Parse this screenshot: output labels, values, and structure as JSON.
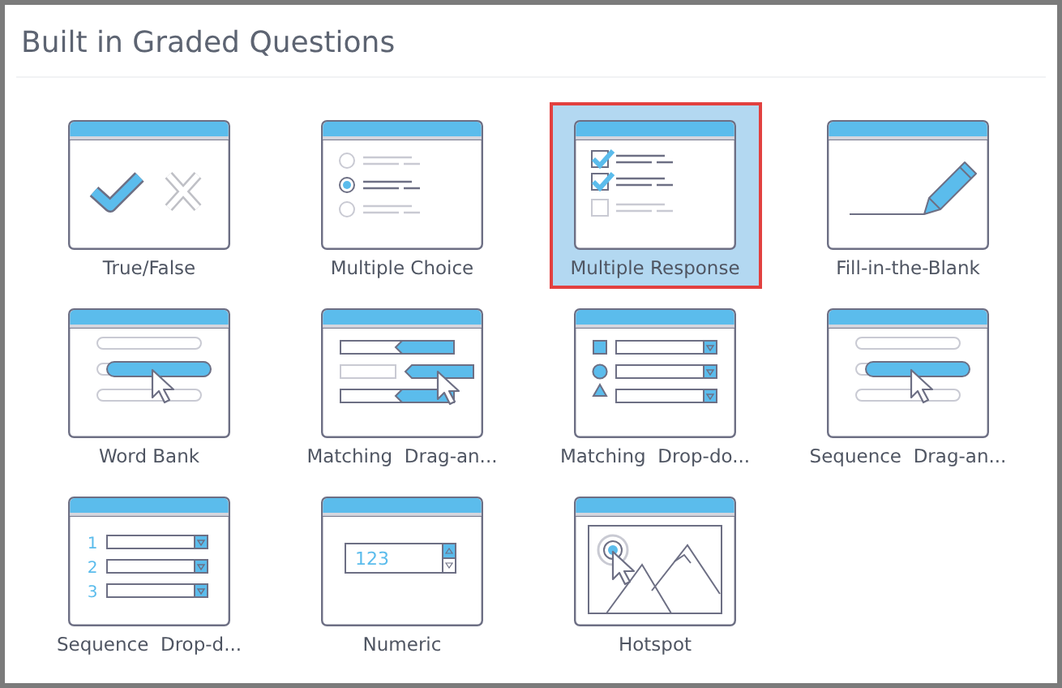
{
  "panel": {
    "title": "Built in Graded Questions"
  },
  "tiles": [
    {
      "label": "True/False",
      "kind": "true-false",
      "selected": false
    },
    {
      "label": "Multiple Choice",
      "kind": "multiple-choice",
      "selected": false
    },
    {
      "label": "Multiple Response",
      "kind": "multiple-response",
      "selected": true
    },
    {
      "label": "Fill-in-the-Blank",
      "kind": "fill-blank",
      "selected": false
    },
    {
      "label": "Word Bank",
      "kind": "word-bank",
      "selected": false
    },
    {
      "label": "Matching  Drag-an...",
      "kind": "matching-drag",
      "selected": false
    },
    {
      "label": "Matching  Drop-do...",
      "kind": "matching-drop",
      "selected": false
    },
    {
      "label": "Sequence  Drag-an...",
      "kind": "sequence-drag",
      "selected": false
    },
    {
      "label": "Sequence  Drop-d...",
      "kind": "sequence-drop",
      "selected": false,
      "icon_texts": [
        "1",
        "2",
        "3"
      ]
    },
    {
      "label": "Numeric",
      "kind": "numeric",
      "selected": false,
      "icon_texts": [
        "123"
      ]
    },
    {
      "label": "Hotspot",
      "kind": "hotspot",
      "selected": false
    }
  ]
}
